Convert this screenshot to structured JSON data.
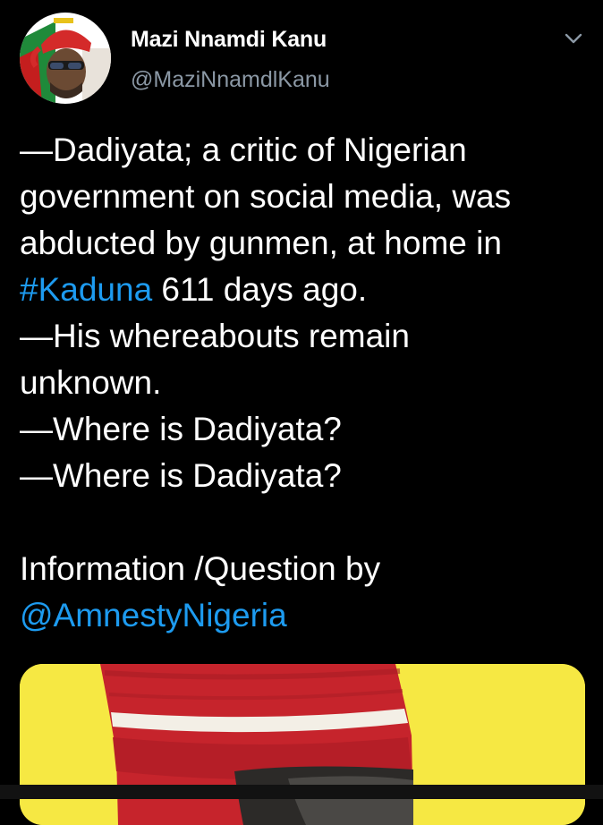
{
  "author": {
    "display_name": "Mazi Nnamdi Kanu",
    "handle": "@MaziNnamdlKanu",
    "avatar_icon": "profile-photo"
  },
  "menu": {
    "icon": "chevron-down-icon"
  },
  "tweet": {
    "line1": "—Dadiyata; a critic of Nigerian",
    "line2": "government on social media, was",
    "line3": "abducted by gunmen, at home in",
    "hashtag": "#Kaduna",
    "line4_rest": " 611 days ago.",
    "line5": "—His whereabouts remain",
    "line6": "unknown.",
    "line7": "—Where is Dadiyata?",
    "line8": "—Where is Dadiyata?",
    "line9": "Information /Question by",
    "mention": "@AmnestyNigeria"
  },
  "media": {
    "type": "image",
    "background": "#f6e843"
  },
  "colors": {
    "background": "#000000",
    "text": "#ffffff",
    "secondary": "#8b98a5",
    "link": "#1d9bf0"
  }
}
